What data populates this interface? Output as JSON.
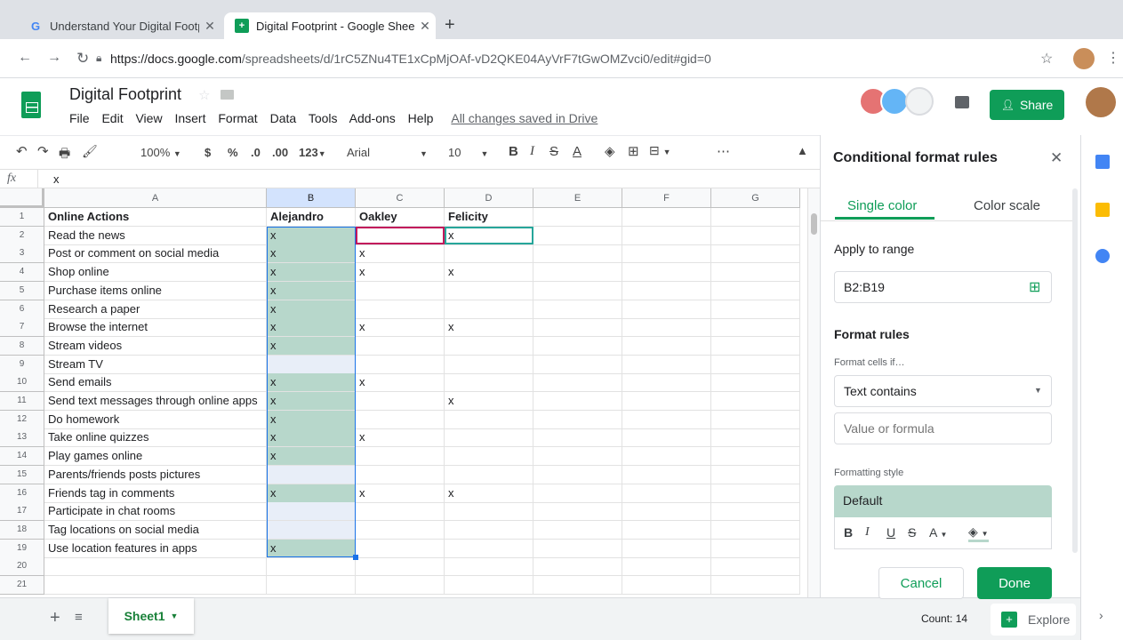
{
  "browser": {
    "tabs": [
      {
        "label": "Understand Your Digital Footpr",
        "active": false
      },
      {
        "label": "Digital Footprint - Google Shee",
        "active": true
      }
    ],
    "url_host": "https://docs.google.com",
    "url_path": "/spreadsheets/d/1rC5ZNu4TE1xCpMjOAf-vD2QKE04AyVrF7tGwOMZvci0/edit#gid=0"
  },
  "doc": {
    "title": "Digital Footprint",
    "menu": [
      "File",
      "Edit",
      "View",
      "Insert",
      "Format",
      "Data",
      "Tools",
      "Add-ons",
      "Help"
    ],
    "saved_status": "All changes saved in Drive",
    "share_label": "Share"
  },
  "toolbar": {
    "zoom": "100%",
    "currency": "$",
    "percent": "%",
    "dec_decrease": ".0",
    "dec_increase": ".00",
    "format_more": "123",
    "font": "Arial",
    "font_size": "10",
    "more": "⋯"
  },
  "formula_bar": {
    "fx": "fx",
    "value": "x"
  },
  "sheet": {
    "columns": [
      "A",
      "B",
      "C",
      "D",
      "E",
      "F",
      "G"
    ],
    "rows": [
      {
        "n": "1",
        "a": "Online Actions",
        "b": "Alejandro",
        "c": "Oakley",
        "d": "Felicity"
      },
      {
        "n": "2",
        "a": "Read the news",
        "b": "x",
        "c": "",
        "d": "x"
      },
      {
        "n": "3",
        "a": "Post or comment on social media",
        "b": "x",
        "c": "x",
        "d": ""
      },
      {
        "n": "4",
        "a": "Shop online",
        "b": "x",
        "c": "x",
        "d": "x"
      },
      {
        "n": "5",
        "a": "Purchase items online",
        "b": "x",
        "c": "",
        "d": ""
      },
      {
        "n": "6",
        "a": "Research a paper",
        "b": "x",
        "c": "",
        "d": ""
      },
      {
        "n": "7",
        "a": "Browse the internet",
        "b": "x",
        "c": "x",
        "d": "x"
      },
      {
        "n": "8",
        "a": "Stream videos",
        "b": "x",
        "c": "",
        "d": ""
      },
      {
        "n": "9",
        "a": "Stream TV",
        "b": "",
        "c": "",
        "d": ""
      },
      {
        "n": "10",
        "a": "Send emails",
        "b": "x",
        "c": "x",
        "d": ""
      },
      {
        "n": "11",
        "a": "Send text messages through online apps",
        "b": "x",
        "c": "",
        "d": "x"
      },
      {
        "n": "12",
        "a": "Do homework",
        "b": "x",
        "c": "",
        "d": ""
      },
      {
        "n": "13",
        "a": "Take online quizzes",
        "b": "x",
        "c": "x",
        "d": ""
      },
      {
        "n": "14",
        "a": "Play games online",
        "b": "x",
        "c": "",
        "d": ""
      },
      {
        "n": "15",
        "a": "Parents/friends posts pictures",
        "b": "",
        "c": "",
        "d": ""
      },
      {
        "n": "16",
        "a": "Friends tag in comments",
        "b": "x",
        "c": "x",
        "d": "x"
      },
      {
        "n": "17",
        "a": "Participate in chat rooms",
        "b": "",
        "c": "",
        "d": ""
      },
      {
        "n": "18",
        "a": "Tag locations on social media",
        "b": "",
        "c": "",
        "d": ""
      },
      {
        "n": "19",
        "a": "Use location features in apps",
        "b": "x",
        "c": "",
        "d": ""
      },
      {
        "n": "20",
        "a": "",
        "b": "",
        "c": "",
        "d": ""
      },
      {
        "n": "21",
        "a": "",
        "b": "",
        "c": "",
        "d": ""
      }
    ]
  },
  "bottom": {
    "sheet_tab": "Sheet1",
    "count": "Count: 14",
    "explore": "Explore"
  },
  "panel": {
    "title": "Conditional format rules",
    "tab_single": "Single color",
    "tab_scale": "Color scale",
    "apply_label": "Apply to range",
    "range": "B2:B19",
    "rules_label": "Format rules",
    "cells_if_label": "Format cells if…",
    "condition": "Text contains",
    "value_placeholder": "Value or formula",
    "style_label": "Formatting style",
    "style_default": "Default",
    "cancel": "Cancel",
    "done": "Done"
  },
  "colors": {
    "accent_green": "#0f9d58",
    "highlight_fill": "#b7d7cb",
    "selection_blue": "#1a73e8",
    "empty_selected": "#e8eef8"
  }
}
